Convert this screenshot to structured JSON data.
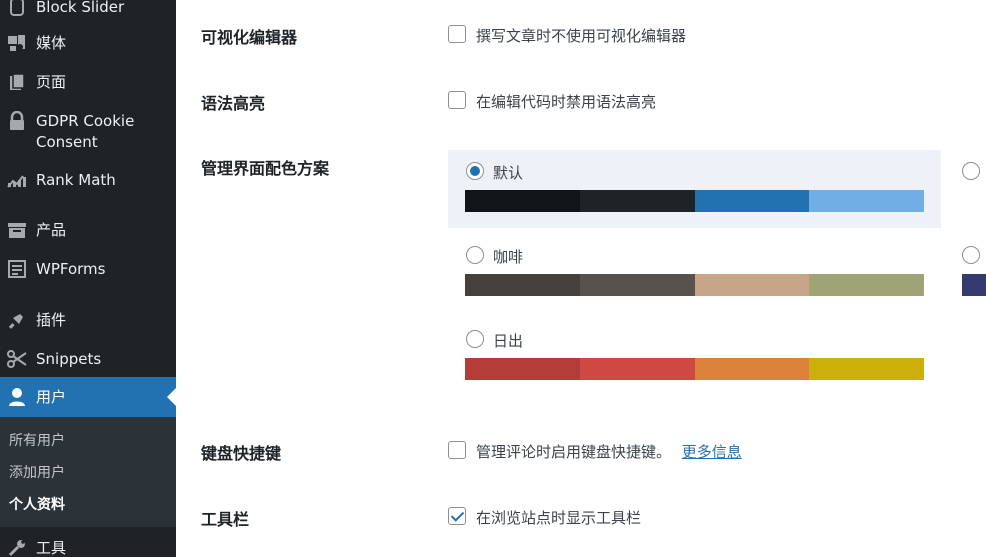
{
  "sidebar": {
    "items": [
      {
        "label": "Block Slider",
        "icon": "slider-icon"
      },
      {
        "label": "媒体",
        "icon": "media-icon"
      },
      {
        "label": "页面",
        "icon": "page-icon"
      },
      {
        "label": "GDPR Cookie\nConsent",
        "line1": "GDPR Cookie",
        "line2": "Consent",
        "icon": "lock-icon"
      },
      {
        "label": "Rank Math",
        "icon": "chart-icon"
      },
      {
        "label": "产品",
        "icon": "archive-icon"
      },
      {
        "label": "WPForms",
        "icon": "form-icon"
      },
      {
        "label": "插件",
        "icon": "plugin-icon"
      },
      {
        "label": "Snippets",
        "icon": "scissors-icon"
      },
      {
        "label": "用户",
        "icon": "user-icon"
      },
      {
        "label": "工具",
        "icon": "wrench-icon"
      }
    ],
    "submenu": [
      "所有用户",
      "添加用户",
      "个人资料"
    ]
  },
  "settings": {
    "visual_editor": {
      "label": "可视化编辑器",
      "option": "撰写文章时不使用可视化编辑器",
      "checked": false
    },
    "syntax": {
      "label": "语法高亮",
      "option": "在编辑代码时禁用语法高亮",
      "checked": false
    },
    "color_scheme": {
      "label": "管理界面配色方案",
      "schemes": [
        {
          "name": "默认",
          "selected": true,
          "colors": [
            "#101517",
            "#1d2327",
            "#2271b1",
            "#72aee6"
          ]
        },
        {
          "name": "咖啡",
          "selected": false,
          "colors": [
            "#46403c",
            "#59524c",
            "#c7a589",
            "#9ea476"
          ]
        },
        {
          "name": "日出",
          "selected": false,
          "colors": [
            "#b43c38",
            "#cf4944",
            "#dd823b",
            "#ccaf0b"
          ]
        }
      ],
      "partial_right_color": "#363b3f",
      "partial_right_color2": "#4b4f8c"
    },
    "keyboard": {
      "label": "键盘快捷键",
      "option": "管理评论时启用键盘快捷键。",
      "link": "更多信息",
      "checked": false
    },
    "toolbar": {
      "label": "工具栏",
      "option": "在浏览站点时显示工具栏",
      "checked": true
    }
  }
}
